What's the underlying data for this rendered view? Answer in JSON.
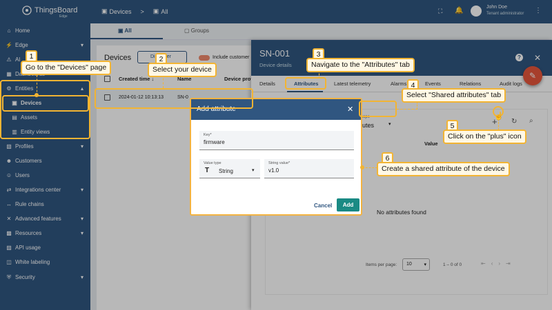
{
  "brand": {
    "name": "ThingsBoard",
    "sub": "Edge"
  },
  "sidebar": {
    "items": [
      {
        "label": "Home",
        "icon": "home-icon"
      },
      {
        "label": "Edge",
        "icon": "edge-icon"
      },
      {
        "label": "Al",
        "icon": "alarm-icon"
      },
      {
        "label": "Dashboards",
        "icon": "dashboard-icon"
      },
      {
        "label": "Entities",
        "icon": "entities-icon"
      },
      {
        "label": "Devices",
        "icon": "device-icon"
      },
      {
        "label": "Assets",
        "icon": "asset-icon"
      },
      {
        "label": "Entity views",
        "icon": "entity-view-icon"
      },
      {
        "label": "Profiles",
        "icon": "profiles-icon"
      },
      {
        "label": "Customers",
        "icon": "customers-icon"
      },
      {
        "label": "Users",
        "icon": "users-icon"
      },
      {
        "label": "Integrations center",
        "icon": "integrations-icon"
      },
      {
        "label": "Rule chains",
        "icon": "rule-chains-icon"
      },
      {
        "label": "Advanced features",
        "icon": "advanced-icon"
      },
      {
        "label": "Resources",
        "icon": "resources-icon"
      },
      {
        "label": "API usage",
        "icon": "api-usage-icon"
      },
      {
        "label": "White labeling",
        "icon": "white-labeling-icon"
      },
      {
        "label": "Security",
        "icon": "security-icon"
      }
    ]
  },
  "topbar": {
    "breadcrumb_devices": "Devices",
    "breadcrumb_sep": ">",
    "breadcrumb_all": "All",
    "user_name": "John Doe",
    "user_role": "Tenant administrator"
  },
  "main_tabs": {
    "all": "All",
    "groups": "Groups"
  },
  "devices": {
    "title": "Devices",
    "filter_btn": "Device Filter",
    "filter_btn_visible": "Di    e Filter",
    "include_customers": "Include customer",
    "col_created": "Created time",
    "col_name": "Name",
    "col_profile": "Device profil",
    "row_created": "2024-01-12 10:13:13",
    "row_name": "SN-0"
  },
  "details": {
    "title": "SN-001",
    "subtitle": "Device details",
    "tabs": [
      "Details",
      "Attributes",
      "Latest telemetry",
      "Alarms",
      "Events",
      "Relations",
      "Audit logs"
    ],
    "scope_label": "scope",
    "scope_value": "butes",
    "col_value": "Value",
    "empty": "No attributes found",
    "items_per_page_label": "Items per page:",
    "items_per_page": "10",
    "range": "1 – 0 of 0"
  },
  "dialog": {
    "title": "Add attribute",
    "key_label": "Key*",
    "key_value": "firmware",
    "type_label": "Value type",
    "type_value": "String",
    "string_label": "String value*",
    "string_value": "v1.0",
    "cancel": "Cancel",
    "add": "Add"
  },
  "callouts": {
    "n1": "1",
    "t1": "Go to the \"Devices\" page",
    "n2": "2",
    "t2": "Select your device",
    "n3": "3",
    "t3": "Navigate to the \"Attributes\" tab",
    "n4": "4",
    "t4": "Select \"Shared attributes\" tab",
    "n5": "5",
    "t5": "Click on the \"plus\" icon",
    "n6": "6",
    "t6": "Create a shared attribute of the device"
  },
  "colors": {
    "primary": "#305680",
    "accent": "#f2b433",
    "add_button": "#1a8a84",
    "fab": "#e8573c"
  }
}
